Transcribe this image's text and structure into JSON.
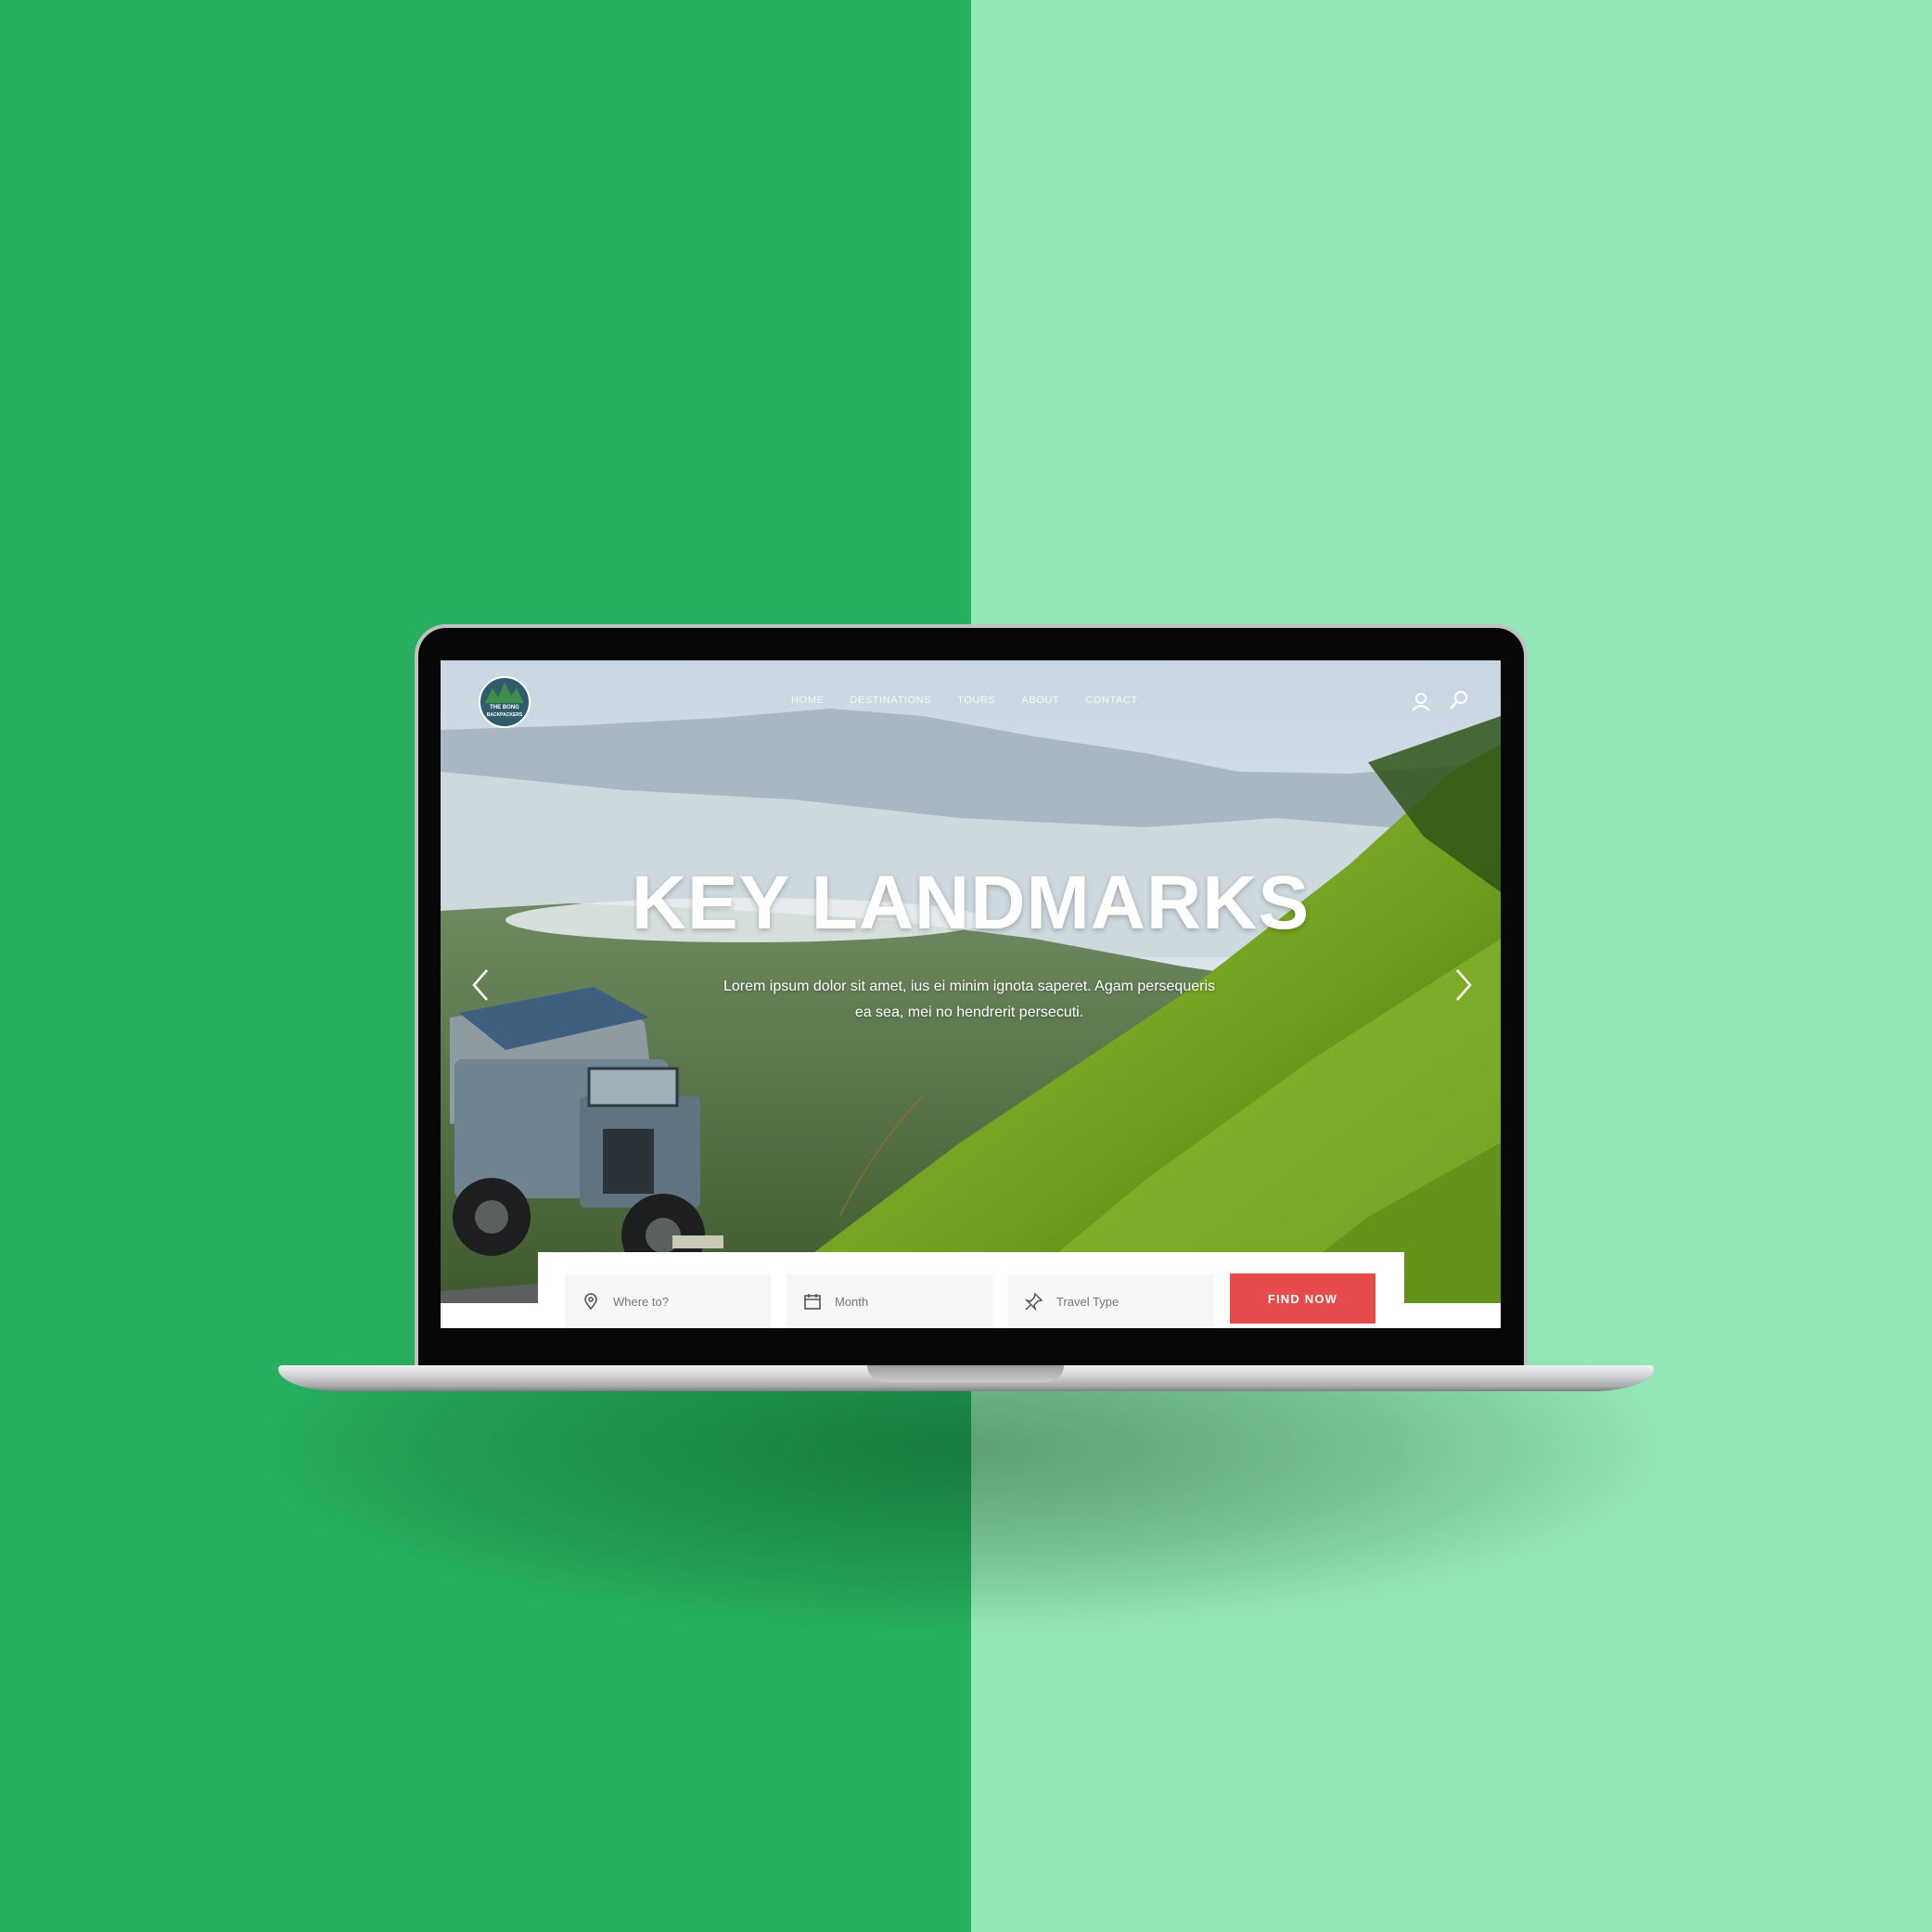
{
  "colors": {
    "background_left": "#27ae60",
    "background_right": "#93e6b5",
    "accent_button": "#e54b4b"
  },
  "site": {
    "logo_line1": "THE BONG",
    "logo_line2": "BACKPACKERS"
  },
  "nav": {
    "items": [
      "HOME",
      "DESTINATIONS",
      "TOURS",
      "ABOUT",
      "CONTACT"
    ]
  },
  "icons": {
    "user": "user-icon",
    "search": "search-icon",
    "prev": "chevron-left-icon",
    "next": "chevron-right-icon",
    "location": "map-pin-icon",
    "calendar": "calendar-icon",
    "travel_type": "pin-icon"
  },
  "hero": {
    "title": "KEY LANDMARKS",
    "subtitle": "Lorem ipsum dolor sit amet, ius ei minim ignota saperet. Agam persequeris ea sea, mei no hendrerit persecuti."
  },
  "search": {
    "where_placeholder": "Where to?",
    "month_placeholder": "Month",
    "travel_type_placeholder": "Travel Type",
    "button_label": "FIND NOW"
  }
}
